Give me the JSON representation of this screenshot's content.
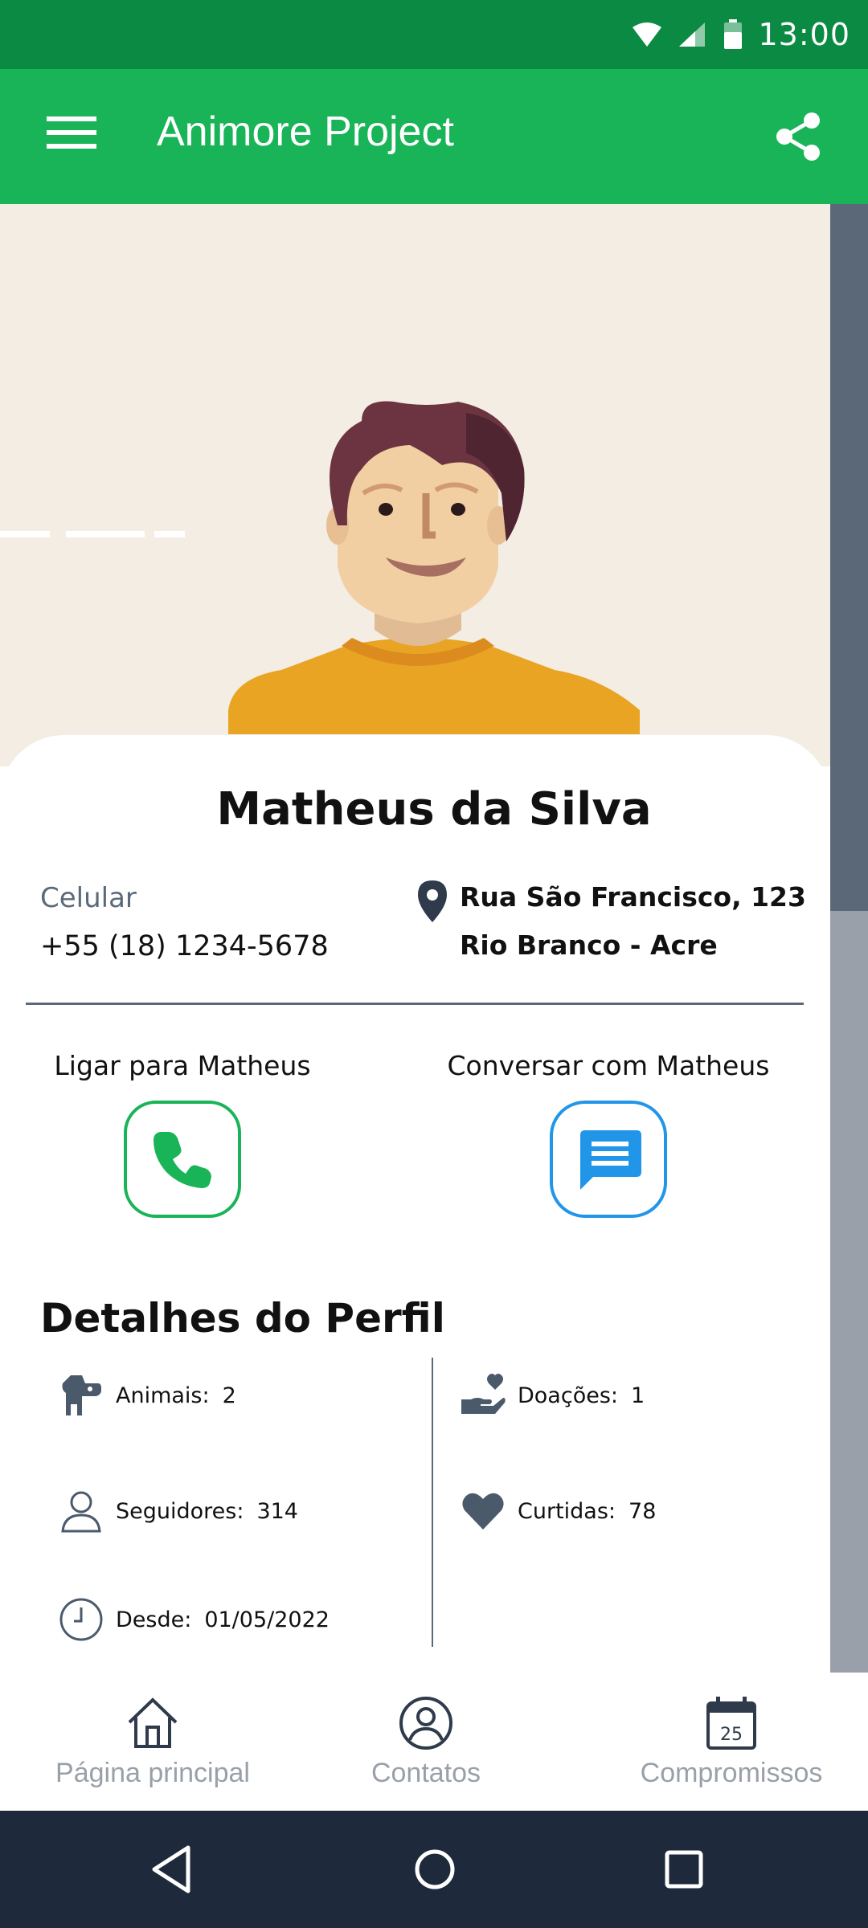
{
  "status_bar": {
    "time": "13:00"
  },
  "app_bar": {
    "title": "Animore Project"
  },
  "profile": {
    "name": "Matheus da Silva",
    "phone_label": "Celular",
    "phone": "+55 (18) 1234-5678",
    "address_line1": "Rua São Francisco, 123",
    "address_line2": "Rio Branco - Acre"
  },
  "actions": {
    "call_label": "Ligar para Matheus",
    "chat_label": "Conversar com Matheus"
  },
  "details": {
    "title": "Detalhes do Perfil",
    "stats": [
      {
        "label": "Animais:",
        "value": "2",
        "icon": "dog-icon"
      },
      {
        "label": "Doações:",
        "value": "1",
        "icon": "donation-icon"
      },
      {
        "label": "Seguidores:",
        "value": "314",
        "icon": "user-icon"
      },
      {
        "label": "Curtidas:",
        "value": "78",
        "icon": "heart-icon"
      },
      {
        "label": "Desde:",
        "value": "01/05/2022",
        "icon": "clock-icon"
      }
    ]
  },
  "bottom_nav": {
    "items": [
      {
        "label": "Página principal",
        "icon": "home-icon"
      },
      {
        "label": "Contatos",
        "icon": "contacts-icon"
      },
      {
        "label": "Compromissos",
        "icon": "calendar-icon",
        "badge": "25"
      }
    ]
  },
  "colors": {
    "status_bar": "#0b8a43",
    "app_bar": "#19b457",
    "hero_bg": "#f4ede4",
    "call_accent": "#19b457",
    "chat_accent": "#2196e8",
    "system_nav": "#1e2a3c"
  }
}
